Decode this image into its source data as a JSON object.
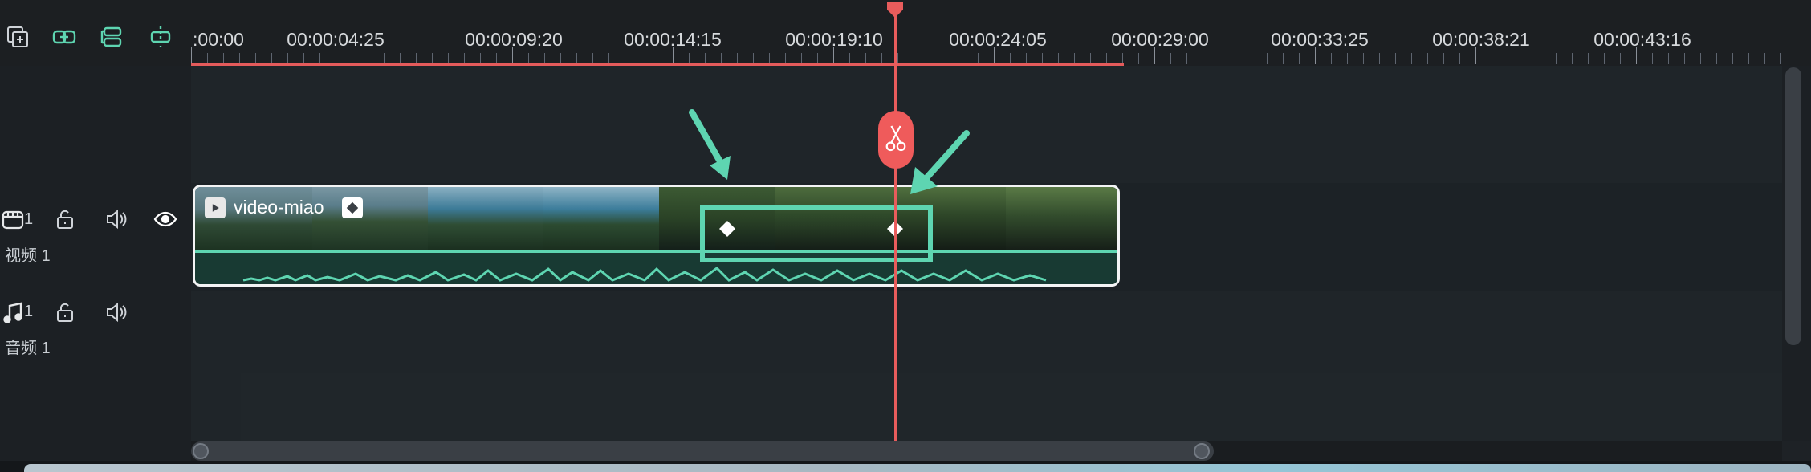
{
  "toolbar": {
    "icons": [
      "add-track-icon",
      "link-icon",
      "group-icon",
      "split-icon"
    ]
  },
  "ruler": {
    "labels": [
      "00:00",
      "00:00:04:25",
      "00:00:09:20",
      "00:00:14:15",
      "00:00:19:10",
      "00:00:24:05",
      "00:00:29:00",
      "00:00:33:25",
      "00:00:38:21",
      "00:00:43:16"
    ],
    "first_label_visible": ":00:00"
  },
  "tracks": {
    "video": {
      "number": "1",
      "name": "视频 1",
      "icons": [
        "video-track-icon",
        "lock-icon",
        "speaker-icon",
        "eye-icon"
      ]
    },
    "audio": {
      "number": "1",
      "name": "音频 1",
      "icons": [
        "music-note-icon",
        "lock-icon",
        "speaker-icon"
      ]
    }
  },
  "clip": {
    "name": "video-miao",
    "icons": [
      "play-icon",
      "keyframe-icon"
    ]
  },
  "playhead": {
    "icon": "scissors-icon"
  },
  "colors": {
    "accent": "#5ed5b1",
    "playhead": "#ef5b5b",
    "background": "#1e2226"
  }
}
